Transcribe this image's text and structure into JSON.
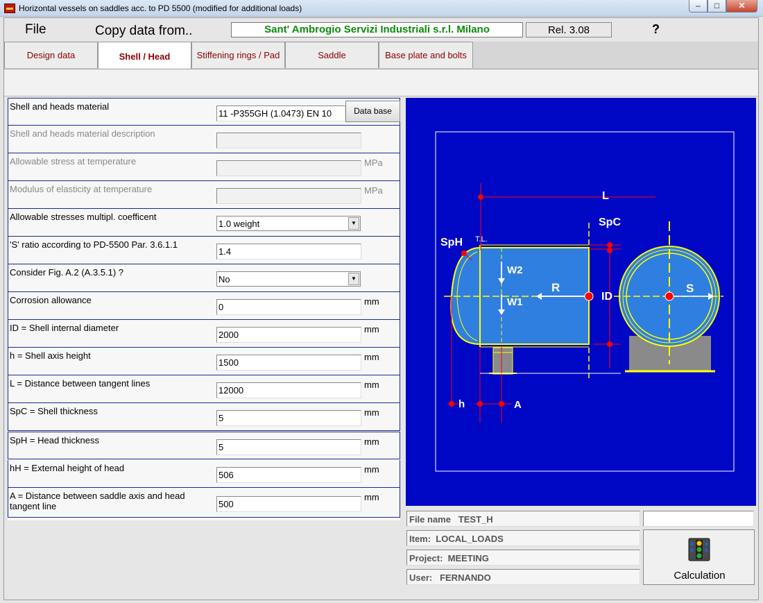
{
  "window": {
    "title": "Horizontal vessels on saddles acc. to PD 5500 (modified for additional loads)"
  },
  "menu": {
    "file": "File",
    "copy": "Copy data from..",
    "company": "Sant' Ambrogio Servizi Industriali s.r.l. Milano",
    "release": "Rel. 3.08",
    "help": "?"
  },
  "tabs": [
    {
      "label": "Design data",
      "active": false
    },
    {
      "label": "Shell / Head",
      "active": true
    },
    {
      "label": "Stiffening rings / Pad",
      "active": false
    },
    {
      "label": "Saddle",
      "active": false
    },
    {
      "label": "Base plate and bolts",
      "active": false
    }
  ],
  "form": {
    "material": {
      "label": "Shell and heads material",
      "value": "11  -P355GH (1.0473) EN 10",
      "button": "Data base"
    },
    "description": {
      "label": "Shell and heads material description",
      "value": ""
    },
    "allowable_stress": {
      "label": "Allowable stress at temperature",
      "value": "",
      "unit": "MPa"
    },
    "modulus": {
      "label": "Modulus of elasticity at temperature",
      "value": "",
      "unit": "MPa"
    },
    "multiplier": {
      "label": "Allowable stresses multipl. coefficent",
      "value": "1.0 weight"
    },
    "s_ratio": {
      "label": "'S' ratio according to PD-5500 Par. 3.6.1.1",
      "value": "1.4"
    },
    "fig_a2": {
      "label": "Consider Fig. A.2 (A.3.5.1) ?",
      "value": "No"
    },
    "corrosion": {
      "label": "Corrosion allowance",
      "value": "0",
      "unit": "mm"
    },
    "id": {
      "label": "ID = Shell internal diameter",
      "value": "2000",
      "unit": "mm"
    },
    "h": {
      "label": "h = Shell axis height",
      "value": "1500",
      "unit": "mm"
    },
    "L": {
      "label": "L = Distance between tangent lines",
      "value": "12000",
      "unit": "mm"
    },
    "spc": {
      "label": "SpC = Shell thickness",
      "value": "5",
      "unit": "mm"
    },
    "sph": {
      "label": "SpH = Head thickness",
      "value": "5",
      "unit": "mm"
    },
    "hH": {
      "label": "hH = External height of head",
      "value": "506",
      "unit": "mm"
    },
    "A": {
      "label": "A = Distance between saddle axis and head tangent line",
      "value": "500",
      "unit": "mm"
    }
  },
  "drawing": {
    "labels": {
      "L": "L",
      "SpC": "SpC",
      "SpH": "SpH",
      "TL": "T.L.",
      "W2": "W2",
      "W1": "W1",
      "R": "R",
      "ID": "ID",
      "S": "S",
      "h": "h",
      "A": "A"
    },
    "colors": {
      "background": "#0008c6",
      "vessel": "#2f7fe0",
      "outline": "#ffff00",
      "dimension": "#ff0000",
      "saddle": "#808080"
    }
  },
  "info": {
    "file_name": "File name   TEST_H",
    "file_extra": "",
    "item": "Item:  LOCAL_LOADS",
    "project": "Project:  MEETING",
    "user": "User:   FERNANDO"
  },
  "calculation": {
    "label": "Calculation",
    "icon": "traffic-light-icon"
  }
}
